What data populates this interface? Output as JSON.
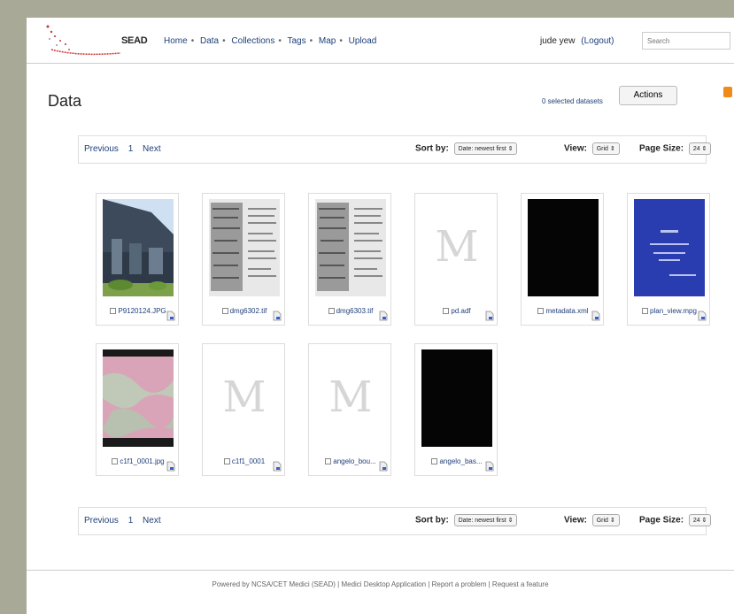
{
  "header": {
    "brand": "SEAD",
    "nav": [
      "Home",
      "Data",
      "Collections",
      "Tags",
      "Map",
      "Upload"
    ],
    "user": "jude yew",
    "logout": "(Logout)",
    "search_placeholder": "Search"
  },
  "main": {
    "title": "Data",
    "selected_datasets": "0 selected datasets",
    "actions_label": "Actions"
  },
  "pager": {
    "previous": "Previous",
    "page": "1",
    "next": "Next",
    "sort_label": "Sort by:",
    "sort_value": "Date: newest first",
    "view_label": "View:",
    "view_value": "Grid",
    "page_size_label": "Page Size:",
    "page_size_value": "24"
  },
  "items": [
    {
      "name": "P9120124.JPG",
      "thumb": "photo-building"
    },
    {
      "name": "dmg6302.tif",
      "thumb": "document-scan"
    },
    {
      "name": "dmg6303.tif",
      "thumb": "document-scan"
    },
    {
      "name": "pd.adf",
      "thumb": "placeholder-m"
    },
    {
      "name": "metadata.xml",
      "thumb": "black"
    },
    {
      "name": "plan_view.mpg",
      "thumb": "blue-slide"
    },
    {
      "name": "c1f1_0001.jpg",
      "thumb": "pink-micrograph"
    },
    {
      "name": "c1f1_0001",
      "thumb": "placeholder-m"
    },
    {
      "name": "angelo_bou...",
      "thumb": "placeholder-m"
    },
    {
      "name": "angelo_bas...",
      "thumb": "black"
    }
  ],
  "footer": {
    "text": "Powered by NCSA/CET Medici (SEAD) | Medici Desktop Application | Report a problem | Request a feature"
  }
}
